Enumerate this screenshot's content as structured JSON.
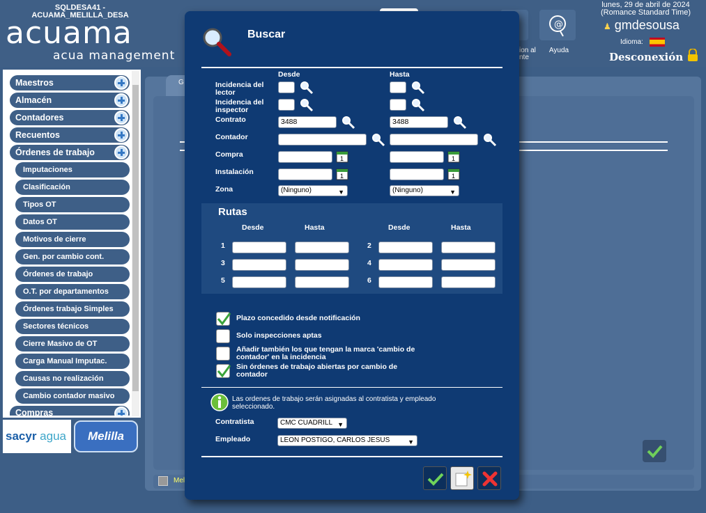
{
  "header": {
    "db_line1": "SQLDESA41 -",
    "db_line2": "ACUAMA_MELILLA_DESA",
    "logo_main": "acuama",
    "logo_sub": "acua management",
    "btn_partial_label1": "ion al",
    "btn_partial_label2": "nte",
    "help_label": "Ayuda",
    "date_line1": "lunes, 29 de abril de 2024",
    "date_line2": "(Romance Standard Time)",
    "username": "gmdesousa",
    "language_label": "Idioma:",
    "logout": "Desconexión"
  },
  "sidebar": {
    "items": [
      {
        "label": "Maestros"
      },
      {
        "label": "Almacén"
      },
      {
        "label": "Contadores"
      },
      {
        "label": "Recuentos"
      },
      {
        "label": "Órdenes de trabajo"
      }
    ],
    "sub_items": [
      {
        "label": "Imputaciones"
      },
      {
        "label": "Clasificación"
      },
      {
        "label": "Tipos OT"
      },
      {
        "label": "Datos OT"
      },
      {
        "label": "Motivos de cierre"
      },
      {
        "label": "Gen. por cambio cont."
      },
      {
        "label": "Órdenes de trabajo"
      },
      {
        "label": "O.T. por departamentos"
      },
      {
        "label": "Órdenes trabajo Simples"
      },
      {
        "label": "Sectores técnicos"
      },
      {
        "label": "Cierre Masivo de OT"
      },
      {
        "label": "Carga Manual Imputac."
      },
      {
        "label": "Causas no realización"
      },
      {
        "label": "Cambio contador masivo"
      }
    ],
    "last_item": "Compras",
    "sacyr_brand": "sacyr",
    "sacyr_agua": "agua",
    "melilla": "Melilla"
  },
  "background": {
    "tab_partial": "G",
    "bottom_partial": "Mel"
  },
  "modal": {
    "title": "Buscar",
    "col_desde": "Desde",
    "col_hasta": "Hasta",
    "fields": {
      "incidencia_lector": "Incidencia del lector",
      "incidencia_inspector": "Incidencia del inspector",
      "contrato": "Contrato",
      "contador": "Contador",
      "compra": "Compra",
      "instalacion": "Instalación",
      "zona": "Zona"
    },
    "contrato_desde": "3488",
    "contrato_hasta": "3488",
    "zona_desde": "(Ninguno)",
    "zona_hasta": "(Ninguno)",
    "rutas": {
      "title": "Rutas",
      "desde": "Desde",
      "hasta": "Hasta",
      "rows": [
        "1",
        "2",
        "3",
        "4",
        "5",
        "6"
      ]
    },
    "checks": {
      "plazo": {
        "label": "Plazo concedido desde notificación",
        "checked": true
      },
      "solo_aptas": {
        "label": "Solo inspecciones aptas",
        "checked": false
      },
      "anadir_line1": "Añadir también los que tengan la marca 'cambio de",
      "anadir_line2": "contador' en la incidencia",
      "anadir_checked": false,
      "sin_ordenes_line1": "Sin órdenes de trabajo abiertas por cambio de",
      "sin_ordenes_line2": "contador",
      "sin_ordenes_checked": true
    },
    "info_line1": "Las ordenes de trabajo serán asignadas al contratista y empleado",
    "info_line2": "seleccionado.",
    "contratista_label": "Contratista",
    "contratista_value": "CMC CUADRILL",
    "empleado_label": "Empleado",
    "empleado_value": "LEON POSTIGO, CARLOS JESUS"
  }
}
